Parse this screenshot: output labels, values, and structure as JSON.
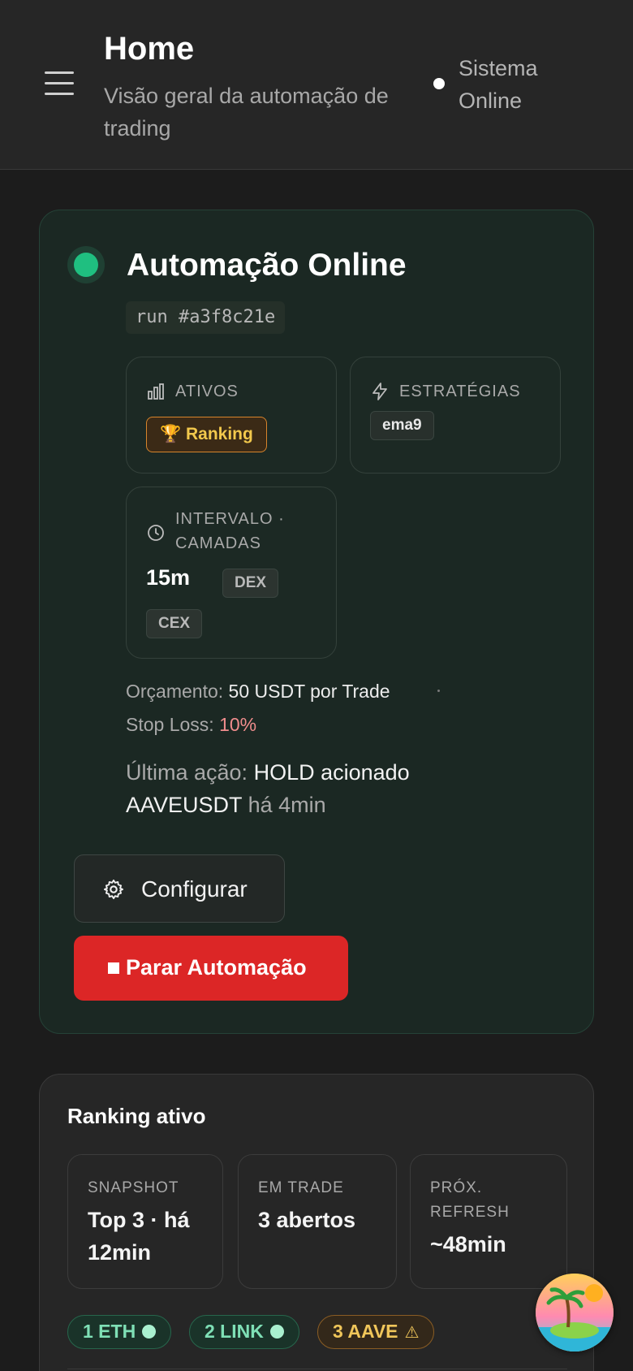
{
  "header": {
    "title": "Home",
    "subtitle": "Visão geral da automação de trading",
    "status": "Sistema Online"
  },
  "automation": {
    "title": "Automação Online",
    "run_id": "run #a3f8c21e",
    "assets": {
      "label": "ATIVOS",
      "badge": "Ranking",
      "badge_icon": "trophy-icon"
    },
    "strategies": {
      "label": "ESTRATÉGIAS",
      "tags": [
        "ema9"
      ]
    },
    "interval": {
      "label": "INTERVALO · CAMADAS",
      "value": "15m",
      "layers": [
        "DEX",
        "CEX"
      ]
    },
    "budget": {
      "label": "Orçamento:",
      "value": "50 USDT por Trade"
    },
    "stop_loss": {
      "label": "Stop Loss:",
      "value": "10%"
    },
    "last_action": {
      "label": "Última ação:",
      "action": "HOLD acionado",
      "symbol": "AAVEUSDT",
      "time": "há 4min"
    },
    "configure_label": "Configurar",
    "stop_label": "Parar Automação",
    "colors": {
      "online": "#1fbf80",
      "stop": "#dc2626",
      "badge": "#f2c84c"
    }
  },
  "ranking": {
    "title": "Ranking ativo",
    "stats": [
      {
        "label": "SNAPSHOT",
        "value": "Top 3 · há 12min"
      },
      {
        "label": "EM TRADE",
        "value": "3 abertos"
      },
      {
        "label": "PRÓX. REFRESH",
        "value": "~48min"
      }
    ],
    "chips": [
      {
        "label": "1 ETH",
        "state": "ok"
      },
      {
        "label": "2 LINK",
        "state": "ok"
      },
      {
        "label": "3 AAVE",
        "state": "warning"
      }
    ]
  }
}
